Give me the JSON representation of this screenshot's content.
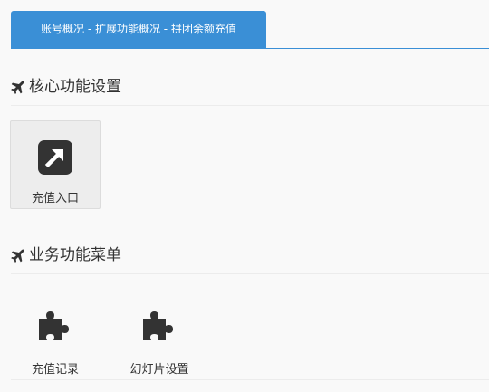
{
  "header": {
    "breadcrumb_tab": "账号概况 - 扩展功能概况 - 拼团余额充值"
  },
  "sections": [
    {
      "title": "核心功能设置",
      "icon": "plane-icon",
      "items": [
        {
          "label": "充值入口",
          "icon": "external-link-icon"
        }
      ]
    },
    {
      "title": "业务功能菜单",
      "icon": "plane-icon",
      "items": [
        {
          "label": "充值记录",
          "icon": "puzzle-piece-icon"
        },
        {
          "label": "幻灯片设置",
          "icon": "puzzle-piece-icon"
        }
      ]
    }
  ],
  "colors": {
    "accent": "#3a8fd6",
    "icon": "#333333",
    "background": "#f9f9f9",
    "tile_bg": "#ededed"
  }
}
